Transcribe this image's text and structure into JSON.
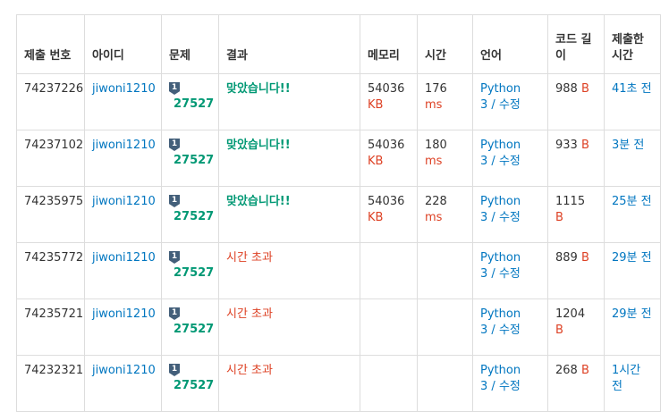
{
  "headers": {
    "submission_id": "제출 번호",
    "user_id": "아이디",
    "problem": "문제",
    "result": "결과",
    "memory": "메모리",
    "time": "시간",
    "language": "언어",
    "code_length": "코드 길이",
    "submitted": "제출한 시간"
  },
  "colors": {
    "accepted": "#009874",
    "time_limit": "#dd4124",
    "link": "#0076c0",
    "tier_badge": "#435f7a"
  },
  "rows": [
    {
      "id": "74237226",
      "user": "jiwoni1210",
      "tier": "1",
      "problem": "27527",
      "result": "맞았습니다!!",
      "status": "accepted",
      "memory": "54036",
      "memory_unit": "KB",
      "time": "176",
      "time_unit": "ms",
      "lang": "Python",
      "lang_ver": "3",
      "lang_sep": " / ",
      "lang_edit": "수정",
      "length": "988",
      "length_unit": "B",
      "ago": "41초 전"
    },
    {
      "id": "74237102",
      "user": "jiwoni1210",
      "tier": "1",
      "problem": "27527",
      "result": "맞았습니다!!",
      "status": "accepted",
      "memory": "54036",
      "memory_unit": "KB",
      "time": "180",
      "time_unit": "ms",
      "lang": "Python",
      "lang_ver": "3",
      "lang_sep": " / ",
      "lang_edit": "수정",
      "length": "933",
      "length_unit": "B",
      "ago": "3분 전"
    },
    {
      "id": "74235975",
      "user": "jiwoni1210",
      "tier": "1",
      "problem": "27527",
      "result": "맞았습니다!!",
      "status": "accepted",
      "memory": "54036",
      "memory_unit": "KB",
      "time": "228",
      "time_unit": "ms",
      "lang": "Python",
      "lang_ver": "3",
      "lang_sep": " / ",
      "lang_edit": "수정",
      "length": "1115",
      "length_unit": "B",
      "ago": "25분 전"
    },
    {
      "id": "74235772",
      "user": "jiwoni1210",
      "tier": "1",
      "problem": "27527",
      "result": "시간 초과",
      "status": "tle",
      "memory": "",
      "memory_unit": "",
      "time": "",
      "time_unit": "",
      "lang": "Python",
      "lang_ver": "3",
      "lang_sep": " / ",
      "lang_edit": "수정",
      "length": "889",
      "length_unit": "B",
      "ago": "29분 전"
    },
    {
      "id": "74235721",
      "user": "jiwoni1210",
      "tier": "1",
      "problem": "27527",
      "result": "시간 초과",
      "status": "tle",
      "memory": "",
      "memory_unit": "",
      "time": "",
      "time_unit": "",
      "lang": "Python",
      "lang_ver": "3",
      "lang_sep": " / ",
      "lang_edit": "수정",
      "length": "1204",
      "length_unit": "B",
      "ago": "29분 전"
    },
    {
      "id": "74232321",
      "user": "jiwoni1210",
      "tier": "1",
      "problem": "27527",
      "result": "시간 초과",
      "status": "tle",
      "memory": "",
      "memory_unit": "",
      "time": "",
      "time_unit": "",
      "lang": "Python",
      "lang_ver": "3",
      "lang_sep": " / ",
      "lang_edit": "수정",
      "length": "268",
      "length_unit": "B",
      "ago": "1시간 전"
    }
  ]
}
